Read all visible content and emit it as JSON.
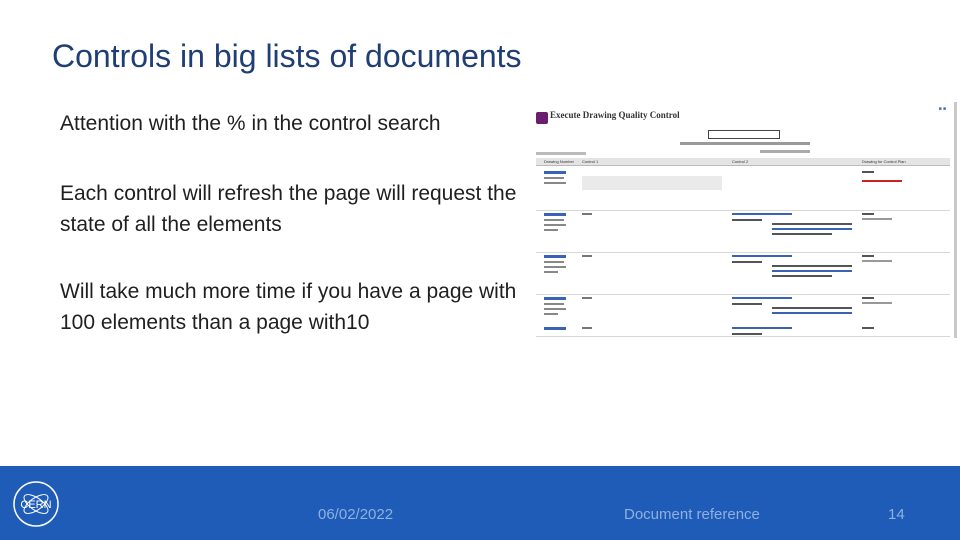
{
  "slide": {
    "title": "Controls in big lists of documents",
    "bullets": [
      "Attention with the % in the control search",
      "Each control will refresh the page will request the state of all the elements",
      "Will take much more time if you have a page with 100 elements than a page with10"
    ]
  },
  "screenshot": {
    "app_title": "Execute Drawing Quality Control",
    "columns": [
      "Drawing Number",
      "Control 1",
      "Control 2",
      "Drawing for Control Plan"
    ],
    "row_count": 5
  },
  "footer": {
    "logo_text": "CERN",
    "date": "06/02/2022",
    "reference": "Document reference",
    "page_number": "14",
    "colors": {
      "bar": "#1f5cb8",
      "text": "#8fb0e0"
    }
  }
}
